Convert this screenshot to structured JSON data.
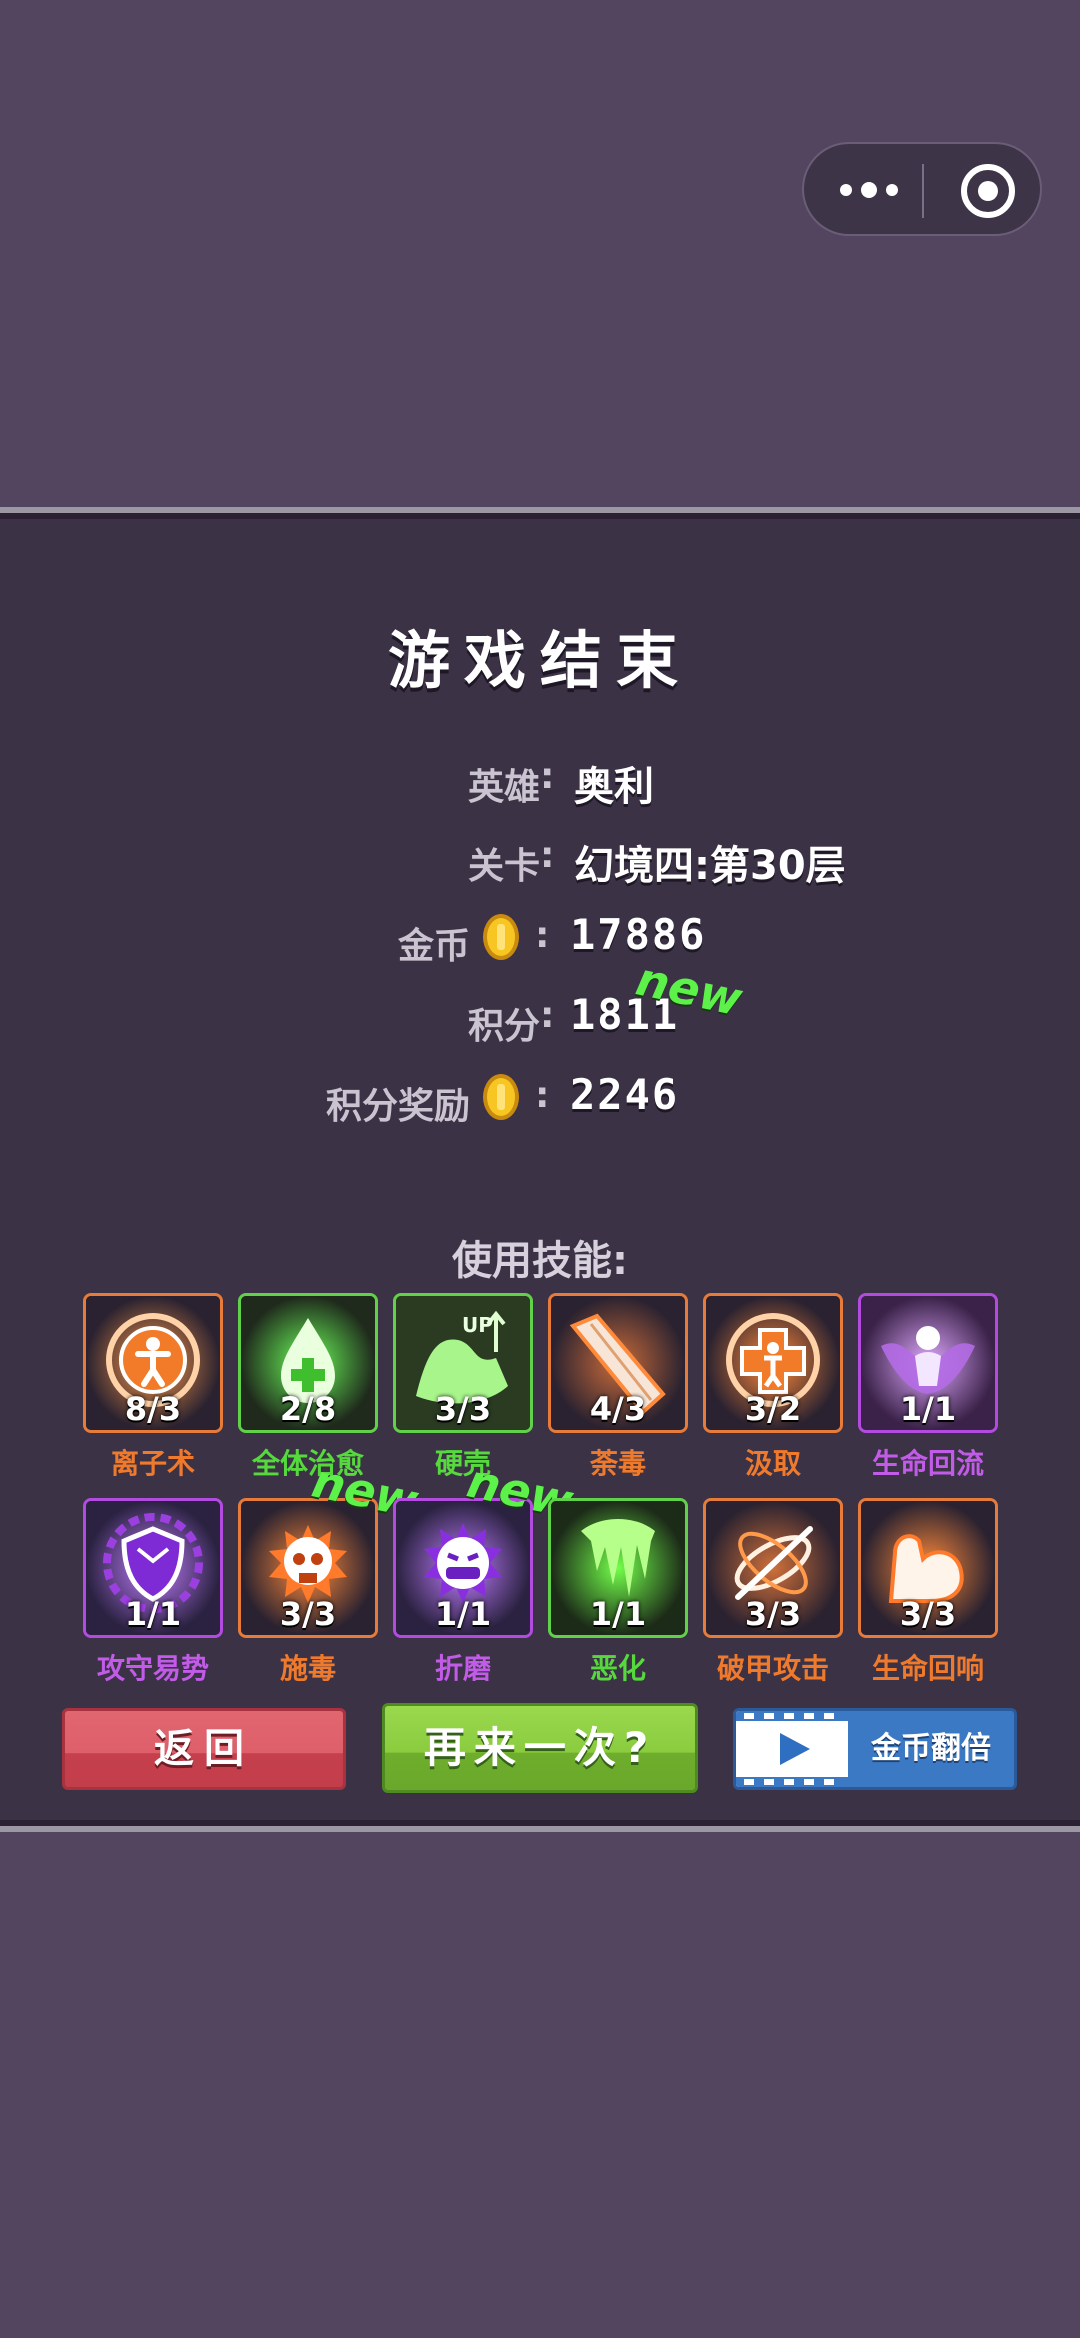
{
  "capsule": {
    "more_icon": "more-dots-icon",
    "close_icon": "target-circle-icon"
  },
  "title": "游戏结束",
  "stats": {
    "hero_label": "英雄",
    "hero_value": "奥利",
    "level_label": "关卡",
    "level_value": "幻境四:第30层",
    "gold_label": "金币",
    "gold_value": "17886",
    "score_label": "积分",
    "score_value": "1811",
    "score_badge": "new",
    "reward_label": "积分奖励",
    "reward_value": "2246",
    "colon": ":"
  },
  "skills_heading": "使用技能:",
  "skills": [
    {
      "name": "离子术",
      "count": "8/3",
      "color": "#f07a2c",
      "icon": "person-circle-icon"
    },
    {
      "name": "全体治愈",
      "count": "2/8",
      "color": "#55d93c",
      "icon": "heal-drop-icon"
    },
    {
      "name": "硬壳",
      "count": "3/3",
      "color": "#55d93c",
      "icon": "arm-up-icon"
    },
    {
      "name": "荼毒",
      "count": "4/3",
      "color": "#f07a2c",
      "icon": "blade-icon"
    },
    {
      "name": "汲取",
      "count": "3/2",
      "color": "#f07a2c",
      "icon": "medic-cross-icon"
    },
    {
      "name": "生命回流",
      "count": "1/1",
      "color": "#c25ce8",
      "icon": "spirit-icon"
    },
    {
      "name": "攻守易势",
      "count": "1/1",
      "color": "#c25ce8",
      "icon": "shield-icon"
    },
    {
      "name": "施毒",
      "count": "3/3",
      "color": "#f07a2c",
      "icon": "skull-icon",
      "badge": "new"
    },
    {
      "name": "折磨",
      "count": "1/1",
      "color": "#c25ce8",
      "icon": "grin-face-icon",
      "badge": "new"
    },
    {
      "name": "恶化",
      "count": "1/1",
      "color": "#55d93c",
      "icon": "slime-icon"
    },
    {
      "name": "破甲攻击",
      "count": "3/3",
      "color": "#f07a2c",
      "icon": "slash-orbit-icon"
    },
    {
      "name": "生命回响",
      "count": "3/3",
      "color": "#f07a2c",
      "icon": "muscle-arm-icon"
    }
  ],
  "buttons": {
    "back": "返回",
    "again": "再来一次?",
    "double": "金币翻倍"
  },
  "colors": {
    "background": "#53455f",
    "panel": "#3c3246",
    "new_badge": "#5cf24a"
  }
}
